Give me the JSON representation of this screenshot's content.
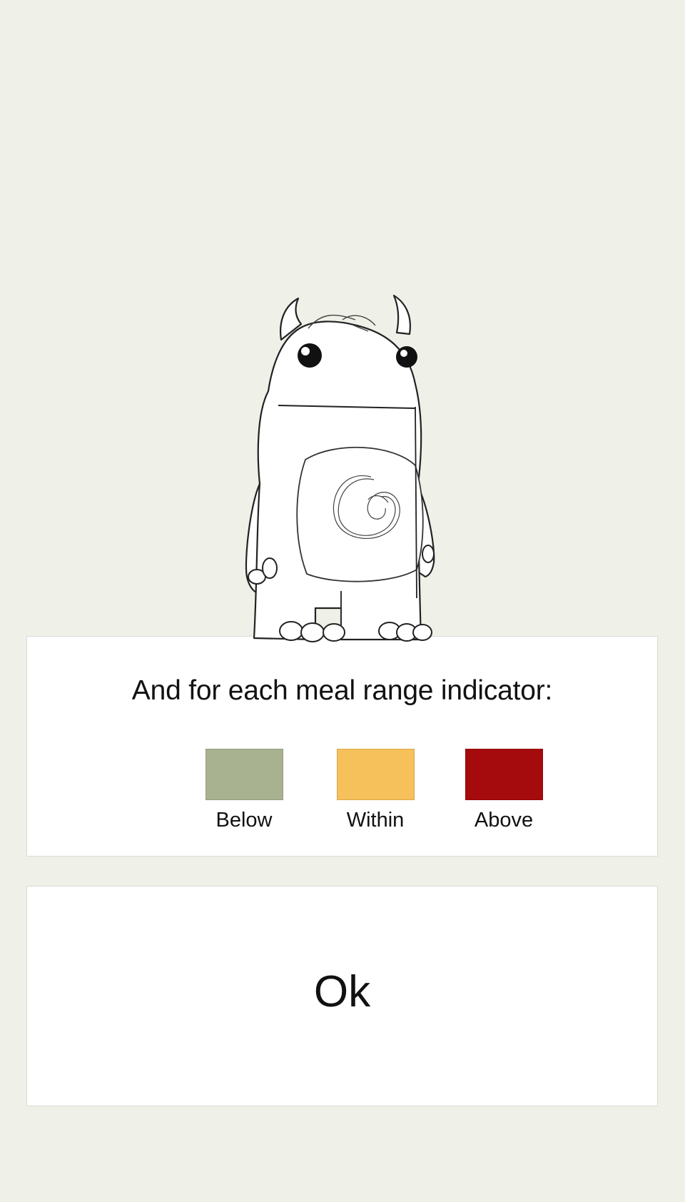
{
  "legend": {
    "title": "And for each meal range indicator:",
    "items": [
      {
        "label": "Below",
        "color": "#a8b290"
      },
      {
        "label": "Within",
        "color": "#f6c05a"
      },
      {
        "label": "Above",
        "color": "#a50a0d"
      }
    ]
  },
  "ok_button": {
    "label": "Ok"
  },
  "mascot": {
    "icon": "monster-mascot-illustration"
  }
}
